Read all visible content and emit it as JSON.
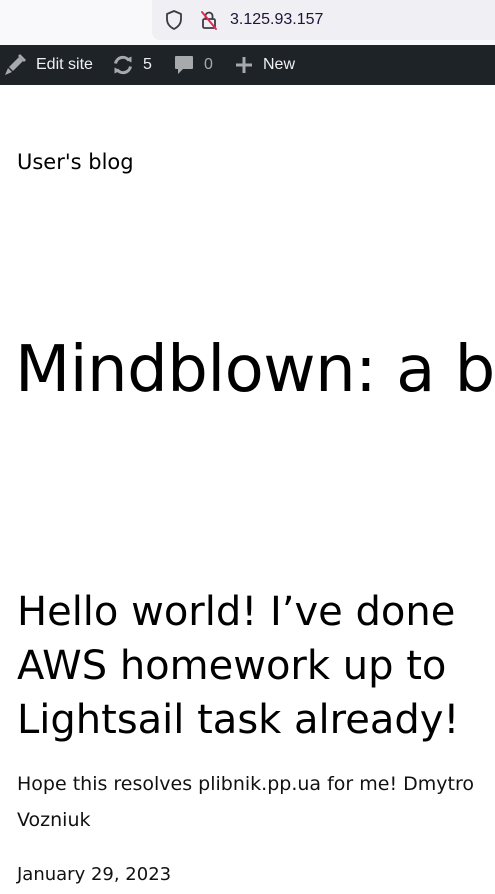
{
  "browser": {
    "url": "3.125.93.157",
    "icons": {
      "shield": "shield-icon",
      "lock": "insecure-lock-icon"
    }
  },
  "admin_bar": {
    "edit_site_label": "Edit site",
    "updates_count": "5",
    "comments_count": "0",
    "new_label": "New",
    "colors": {
      "background": "#1d2327",
      "text": "#f0f0f1",
      "muted": "#a7aaad"
    }
  },
  "site": {
    "title": "User's blog",
    "tagline": "Mindblown: a b"
  },
  "post": {
    "title": "Hello world! I’ve done AWS homework up to Lightsail task already!",
    "excerpt": "Hope this resolves plibnik.pp.ua for me! Dmytro Vozniuk",
    "date": "January 29, 2023"
  }
}
